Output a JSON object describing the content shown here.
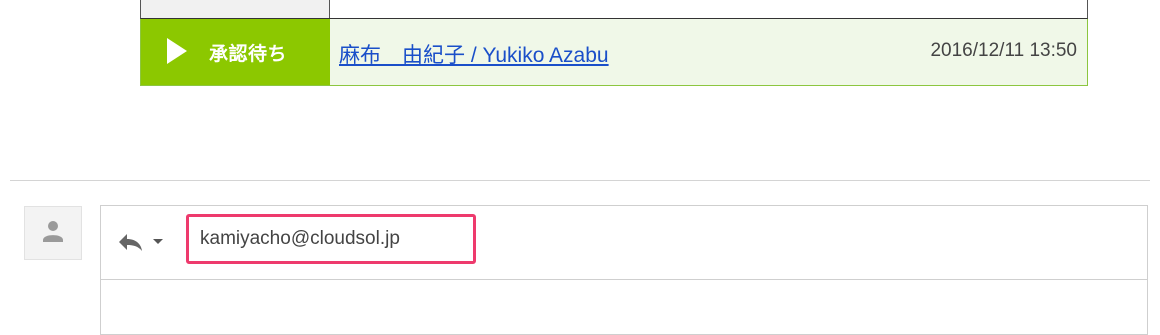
{
  "approval": {
    "status_label": "承認待ち",
    "applicant": "麻布　由紀子 / Yukiko Azabu",
    "date": "2016/12/11 13:50",
    "status_color": "#8cc800"
  },
  "reply": {
    "recipient": "kamiyacho@cloudsol.jp",
    "highlight_color": "#ee3a6d"
  },
  "icons": {
    "status": "play-icon",
    "avatar": "person-icon",
    "reply_type": "reply-arrow-icon",
    "reply_menu": "chevron-down-icon"
  }
}
